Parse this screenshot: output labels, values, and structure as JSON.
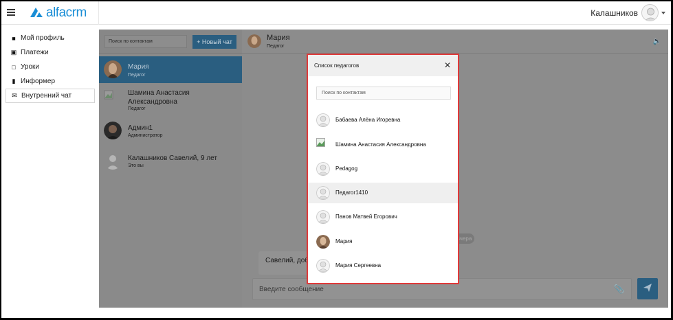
{
  "header": {
    "logo_text": "alfacrm",
    "user_name": "Калашников"
  },
  "nav": {
    "items": [
      {
        "label": "Мой профиль",
        "icon": "person-icon"
      },
      {
        "label": "Платежи",
        "icon": "money-icon"
      },
      {
        "label": "Уроки",
        "icon": "calendar-icon"
      },
      {
        "label": "Информер",
        "icon": "book-icon"
      },
      {
        "label": "Внутренний чат",
        "icon": "envelope-icon"
      }
    ]
  },
  "contacts": {
    "search_placeholder": "Поиск по контактам",
    "new_chat_label": "+ Новый чат",
    "list": [
      {
        "name": "Мария",
        "role": "Педагог"
      },
      {
        "name": "Шамина Анастасия Александровна",
        "role": "Педагог"
      },
      {
        "name": "Админ1",
        "role": "Администратор"
      },
      {
        "name": "Калашников Савелий, 9 лет",
        "role": "Это вы"
      }
    ]
  },
  "conversation": {
    "name": "Мария",
    "role": "Педагог",
    "date_tag": "Вчера",
    "message_preview": "Савелий, добр",
    "composer_placeholder": "Введите сообщение"
  },
  "modal": {
    "title": "Список педагогов",
    "search_placeholder": "Поиск по контактам",
    "teachers": [
      "Бабаева Алёна Игоревна",
      "Шамина Анастасия Александровна",
      "Pedagog",
      "Педагог1410",
      "Панов Матвей Егорович",
      "Мария",
      "Мария Сергеевна"
    ]
  },
  "colors": {
    "accent": "#3a7fb5",
    "highlight_border": "#e03a3a"
  }
}
